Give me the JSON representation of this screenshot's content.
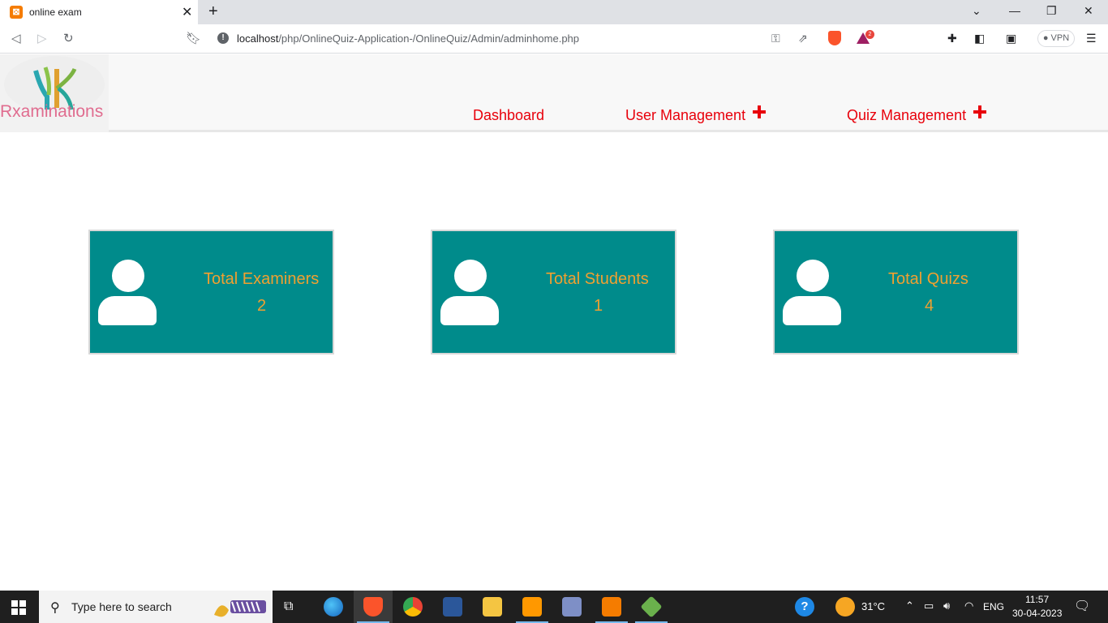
{
  "browser": {
    "tab_title": "online exam",
    "url_host": "localhost",
    "url_path": "/php/OnlineQuiz-Application-/OnlineQuiz/Admin/adminhome.php",
    "bat_badge": "2",
    "vpn_label": "VPN"
  },
  "site": {
    "brand": "Rxaminations",
    "nav": {
      "dashboard": "Dashboard",
      "user_management": "User Management",
      "quiz_management": "Quiz Management"
    }
  },
  "stats": [
    {
      "label": "Total Examiners",
      "value": "2"
    },
    {
      "label": "Total Students",
      "value": "1"
    },
    {
      "label": "Total Quizs",
      "value": "4"
    }
  ],
  "taskbar": {
    "search_placeholder": "Type here to search",
    "weather": "31°C",
    "language": "ENG",
    "time": "11:57",
    "date": "30-04-2023"
  },
  "colors": {
    "card_bg": "#008b8b",
    "card_text": "#f0a030",
    "nav_text": "#e8000b",
    "brand_text": "#e06c8f"
  }
}
